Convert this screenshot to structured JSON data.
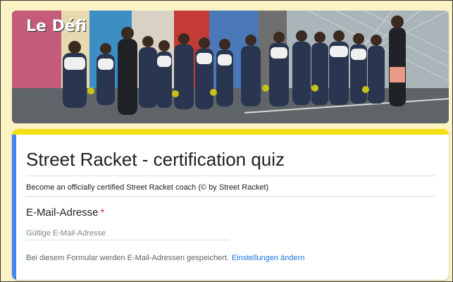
{
  "header_image": {
    "alt": "Group photo of students with rackets",
    "wall_text": "Le Défi"
  },
  "form": {
    "title": "Street Racket - certification quiz",
    "description": "Become an officially certified Street Racket coach (© by Street Racket)",
    "email_field": {
      "label": "E-Mail-Adresse",
      "required_mark": "*",
      "placeholder": "Gültige E-Mail-Adresse",
      "value": ""
    },
    "notice": {
      "text": "Bei diesem Formular werden E-Mail-Adressen gespeichert.",
      "link_label": "Einstellungen ändern"
    }
  },
  "colors": {
    "page_background": "#fbf3c4",
    "card_top_accent": "#f3df16",
    "card_left_accent": "#4285f4",
    "required": "#d93025",
    "link": "#1a73e8"
  }
}
